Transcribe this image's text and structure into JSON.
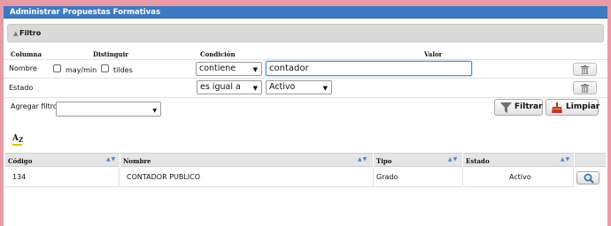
{
  "window": {
    "title": "Administrar Propuestas Formativas"
  },
  "filter_panel": {
    "label": "Filtro"
  },
  "filter_headers": {
    "columna": "Columna",
    "distinguir": "Distinguir",
    "condicion": "Condición",
    "valor": "Valor"
  },
  "filter_rows": [
    {
      "column": "Nombre",
      "case_option": "may/min",
      "accent_option": "tildes",
      "condition": "contiene",
      "value": "contador"
    },
    {
      "column": "Estado",
      "condition": "es igual a",
      "value": "Activo"
    }
  ],
  "add_filter": {
    "label": "Agregar filtro",
    "value": ""
  },
  "buttons": {
    "filter": "Filtrar",
    "clear": "Limpiar"
  },
  "sort_widget": {
    "letter_a": "A",
    "letter_z": "Z"
  },
  "table": {
    "columns": [
      "Código",
      "Nombre",
      "Tipo",
      "Estado"
    ],
    "rows": [
      {
        "codigo": "134",
        "nombre": "CONTADOR PUBLICO",
        "tipo": "Grado",
        "estado": "Activo"
      }
    ]
  },
  "icons": {
    "trash": "trash-icon",
    "funnel": "funnel-icon",
    "broom": "broom-icon",
    "magnifier": "magnifier-icon",
    "sort": "sort-arrows-icon"
  },
  "colors": {
    "title_bar": "#3d7ac4",
    "background": "#e89aa6",
    "sort_arrows": "#4f86c6"
  }
}
